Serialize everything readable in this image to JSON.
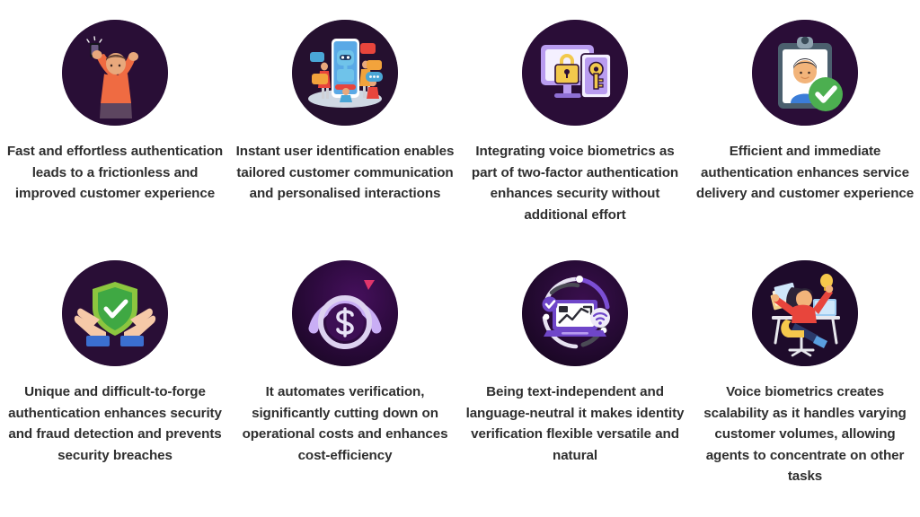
{
  "page": {
    "title": "Voice Biometrics Benefits Infographic",
    "background_color": "#ffffff",
    "text_color": "#2f2f2f",
    "badge_color": "#290e36",
    "layout": "4-column x 2-row icon grid"
  },
  "cards": [
    {
      "id": "card-1",
      "icon": "person-celebrating-with-phone-icon",
      "icon_style": "flat-illustration",
      "text": "Fast and effortless authentication leads to a frictionless and improved customer experience",
      "lines": [
        "Fast and effortless",
        "authentication leads to",
        "a frictionless and",
        "improved customer",
        "experience"
      ]
    },
    {
      "id": "card-2",
      "icon": "chatbot-phone-conversation-icon",
      "icon_style": "flat-illustration",
      "text": "Instant user identification enables tailored customer communication and personalised interactions",
      "lines": [
        "Instant user",
        "identification enables",
        "tailored customer",
        "communication and",
        "personalised interactions"
      ]
    },
    {
      "id": "card-3",
      "icon": "monitor-lock-key-security-icon",
      "icon_style": "flat-illustration",
      "text": "Integrating voice biometrics as part of two-factor authentication enhances security without additional effort",
      "lines": [
        "Integrating voice",
        "biometrics as part of two-",
        "factor authentication",
        "enhances security",
        "without additional effort"
      ]
    },
    {
      "id": "card-4",
      "icon": "id-badge-verified-check-icon",
      "icon_style": "flat-illustration",
      "text": "Efficient and immediate authentication enhances service delivery and customer experience",
      "lines": [
        "Efficient and immediate",
        "authentication enhances",
        "service delivery and",
        "customer experience"
      ]
    },
    {
      "id": "card-5",
      "icon": "hands-holding-shield-check-icon",
      "icon_style": "flat-illustration",
      "text": "Unique and difficult-to-forge authentication enhances security and fraud detection and prevents security breaches",
      "lines": [
        "Unique and difficult-to-forge",
        "authentication enhances",
        "security and fraud detection",
        "and prevents security",
        "breaches"
      ]
    },
    {
      "id": "card-6",
      "icon": "dollar-cost-gauge-icon",
      "icon_style": "flat-illustration",
      "text": "It automates verification, significantly cutting down on operational costs and enhances cost-efficiency",
      "lines": [
        "It automates verification,",
        "significantly cutting down",
        "on operational costs and",
        "enhances cost-efficiency"
      ]
    },
    {
      "id": "card-7",
      "icon": "laptop-growth-chart-wifi-icon",
      "icon_style": "flat-illustration",
      "text": "Being text-independent and language-neutral it makes identity verification flexible versatile and natural",
      "lines": [
        "Being text-independent",
        "and language-neutral it",
        "makes identity",
        "verification flexible",
        "versatile and natural"
      ]
    },
    {
      "id": "card-8",
      "icon": "busy-multitasking-agent-icon",
      "icon_style": "flat-illustration",
      "text": "Voice biometrics creates scalability as it handles varying customer volumes, allowing agents to concentrate on other tasks",
      "lines": [
        "Voice biometrics creates",
        "scalability as it handles",
        "varying customer volumes,",
        "allowing agents to",
        "concentrate on other tasks"
      ]
    }
  ],
  "colors": {
    "badge_dark_purple": "#290e36",
    "accent_orange": "#ef6b42",
    "accent_purple": "#8b5cf6",
    "accent_light_purple": "#c4aef5",
    "accent_green": "#4caf50",
    "accent_yellow": "#f6d04d",
    "accent_blue": "#3b7dd8",
    "accent_red": "#e8453c",
    "text": "#2f2f2f"
  }
}
